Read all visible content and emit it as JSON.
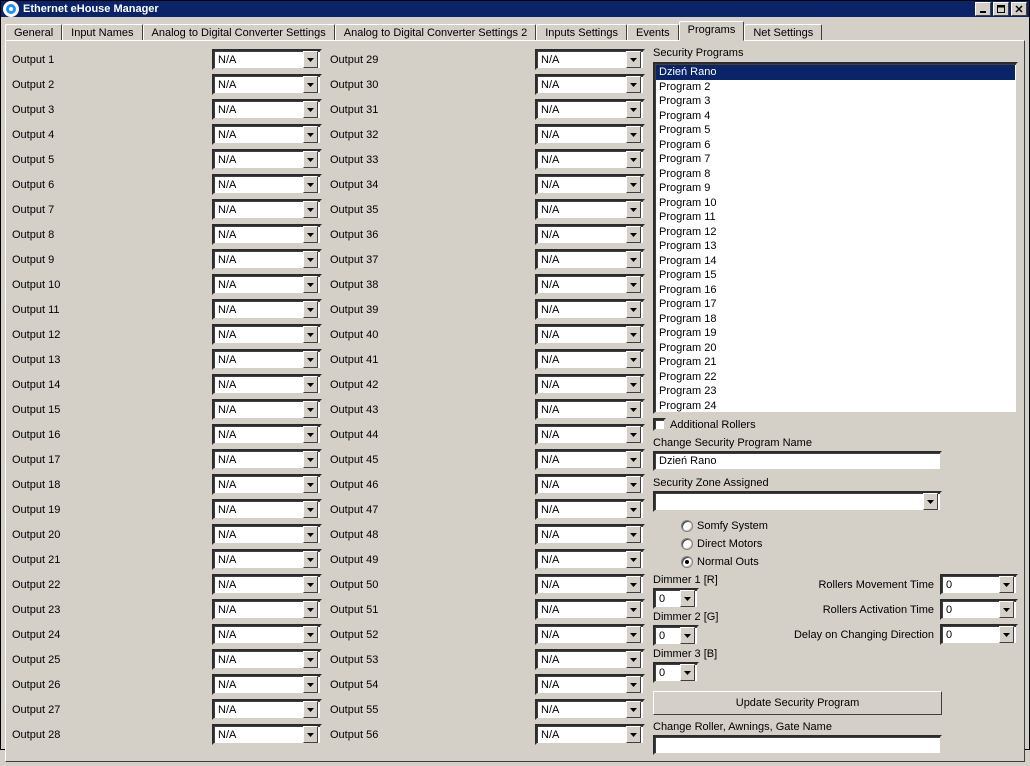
{
  "window": {
    "title": "Ethernet eHouse Manager"
  },
  "tabs": [
    "General",
    "Input Names",
    "Analog to Digital Converter Settings",
    "Analog to Digital Converter Settings 2",
    "Inputs Settings",
    "Events",
    "Programs",
    "Net Settings"
  ],
  "active_tab": "Programs",
  "outputs_col_a": [
    {
      "label": "Output 1",
      "value": "N/A"
    },
    {
      "label": "Output 2",
      "value": "N/A"
    },
    {
      "label": "Output 3",
      "value": "N/A"
    },
    {
      "label": "Output 4",
      "value": "N/A"
    },
    {
      "label": "Output 5",
      "value": "N/A"
    },
    {
      "label": "Output 6",
      "value": "N/A"
    },
    {
      "label": "Output 7",
      "value": "N/A"
    },
    {
      "label": "Output 8",
      "value": "N/A"
    },
    {
      "label": "Output 9",
      "value": "N/A"
    },
    {
      "label": "Output 10",
      "value": "N/A"
    },
    {
      "label": "Output 11",
      "value": "N/A"
    },
    {
      "label": "Output 12",
      "value": "N/A"
    },
    {
      "label": "Output 13",
      "value": "N/A"
    },
    {
      "label": "Output 14",
      "value": "N/A"
    },
    {
      "label": "Output 15",
      "value": "N/A"
    },
    {
      "label": "Output 16",
      "value": "N/A"
    },
    {
      "label": "Output 17",
      "value": "N/A"
    },
    {
      "label": "Output 18",
      "value": "N/A"
    },
    {
      "label": "Output 19",
      "value": "N/A"
    },
    {
      "label": "Output 20",
      "value": "N/A"
    },
    {
      "label": "Output 21",
      "value": "N/A"
    },
    {
      "label": "Output 22",
      "value": "N/A"
    },
    {
      "label": "Output 23",
      "value": "N/A"
    },
    {
      "label": "Output 24",
      "value": "N/A"
    },
    {
      "label": "Output 25",
      "value": "N/A"
    },
    {
      "label": "Output 26",
      "value": "N/A"
    },
    {
      "label": "Output 27",
      "value": "N/A"
    },
    {
      "label": "Output 28",
      "value": "N/A"
    }
  ],
  "outputs_col_b": [
    {
      "label": "Output 29",
      "value": "N/A"
    },
    {
      "label": "Output 30",
      "value": "N/A"
    },
    {
      "label": "Output 31",
      "value": "N/A"
    },
    {
      "label": "Output 32",
      "value": "N/A"
    },
    {
      "label": "Output 33",
      "value": "N/A"
    },
    {
      "label": "Output 34",
      "value": "N/A"
    },
    {
      "label": "Output 35",
      "value": "N/A"
    },
    {
      "label": "Output 36",
      "value": "N/A"
    },
    {
      "label": "Output 37",
      "value": "N/A"
    },
    {
      "label": "Output 38",
      "value": "N/A"
    },
    {
      "label": "Output 39",
      "value": "N/A"
    },
    {
      "label": "Output 40",
      "value": "N/A"
    },
    {
      "label": "Output 41",
      "value": "N/A"
    },
    {
      "label": "Output 42",
      "value": "N/A"
    },
    {
      "label": "Output 43",
      "value": "N/A"
    },
    {
      "label": "Output 44",
      "value": "N/A"
    },
    {
      "label": "Output 45",
      "value": "N/A"
    },
    {
      "label": "Output 46",
      "value": "N/A"
    },
    {
      "label": "Output 47",
      "value": "N/A"
    },
    {
      "label": "Output 48",
      "value": "N/A"
    },
    {
      "label": "Output 49",
      "value": "N/A"
    },
    {
      "label": "Output 50",
      "value": "N/A"
    },
    {
      "label": "Output 51",
      "value": "N/A"
    },
    {
      "label": "Output 52",
      "value": "N/A"
    },
    {
      "label": "Output 53",
      "value": "N/A"
    },
    {
      "label": "Output 54",
      "value": "N/A"
    },
    {
      "label": "Output 55",
      "value": "N/A"
    },
    {
      "label": "Output 56",
      "value": "N/A"
    }
  ],
  "security": {
    "header": "Security Programs",
    "programs": [
      "Dzień Rano",
      "Program 2",
      "Program 3",
      "Program 4",
      "Program 5",
      "Program 6",
      "Program 7",
      "Program 8",
      "Program 9",
      "Program 10",
      "Program 11",
      "Program 12",
      "Program 13",
      "Program 14",
      "Program 15",
      "Program 16",
      "Program 17",
      "Program 18",
      "Program 19",
      "Program 20",
      "Program 21",
      "Program 22",
      "Program 23",
      "Program 24"
    ],
    "selected_index": 0,
    "additional_rollers_label": "Additional Rollers",
    "change_name_label": "Change Security Program Name",
    "change_name_value": "Dzień Rano",
    "zone_label": "Security Zone Assigned",
    "zone_value": "",
    "radio_somfy": "Somfy System",
    "radio_direct": "Direct Motors",
    "radio_normal": "Normal Outs",
    "radio_selected": "normal",
    "dimmer1_label": "Dimmer 1 [R]",
    "dimmer1_value": "0",
    "dimmer2_label": "Dimmer 2 [G]",
    "dimmer2_value": "0",
    "dimmer3_label": "Dimmer 3 [B]",
    "dimmer3_value": "0",
    "rollers_move_label": "Rollers Movement Time",
    "rollers_move_value": "0",
    "rollers_act_label": "Rollers Activation Time",
    "rollers_act_value": "0",
    "delay_label": "Delay on Changing Direction",
    "delay_value": "0",
    "update_button": "Update Security Program",
    "change_roller_label": "Change Roller, Awnings, Gate Name",
    "change_roller_value": ""
  }
}
